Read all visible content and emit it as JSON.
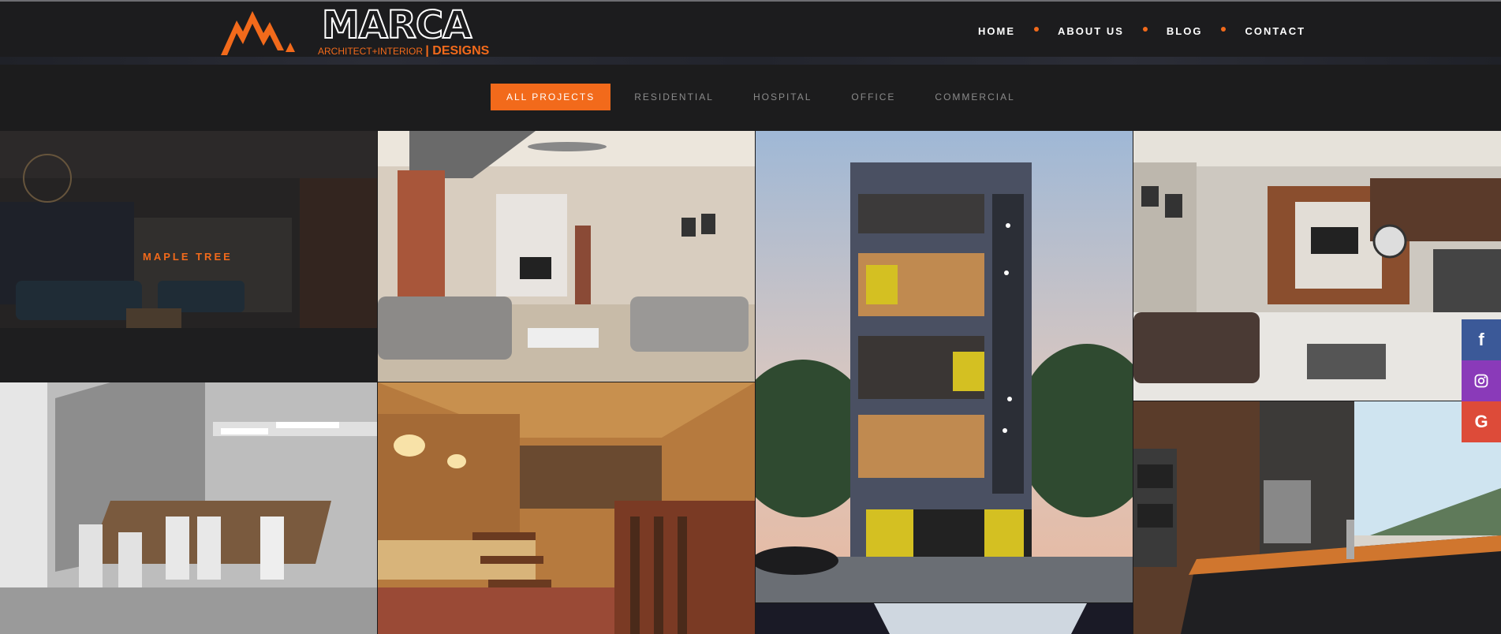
{
  "brand": {
    "name": "MARCA",
    "tagline": "ARCHITECT+INTERIOR",
    "tagline_suffix": "| DESIGNS",
    "accent_color": "#f26a1b"
  },
  "nav": {
    "items": [
      {
        "label": "HOME"
      },
      {
        "label": "ABOUT US"
      },
      {
        "label": "BLOG"
      },
      {
        "label": "CONTACT"
      }
    ]
  },
  "filters": {
    "items": [
      {
        "label": "ALL PROJECTS",
        "active": true
      },
      {
        "label": "RESIDENTIAL",
        "active": false
      },
      {
        "label": "HOSPITAL",
        "active": false
      },
      {
        "label": "OFFICE",
        "active": false
      },
      {
        "label": "COMMERCIAL",
        "active": false
      }
    ]
  },
  "projects": [
    {
      "title": "MAPLE TREE",
      "hovered": true
    },
    {
      "title": ""
    },
    {
      "title": ""
    },
    {
      "title": ""
    },
    {
      "title": ""
    },
    {
      "title": ""
    },
    {
      "title": ""
    },
    {
      "title": ""
    }
  ],
  "social": [
    {
      "icon": "facebook-icon",
      "glyph": "f",
      "color": "#3b5998"
    },
    {
      "icon": "instagram-icon",
      "glyph": "",
      "color": "#8a3ab9"
    },
    {
      "icon": "google-icon",
      "glyph": "G",
      "color": "#dd4b39"
    }
  ]
}
